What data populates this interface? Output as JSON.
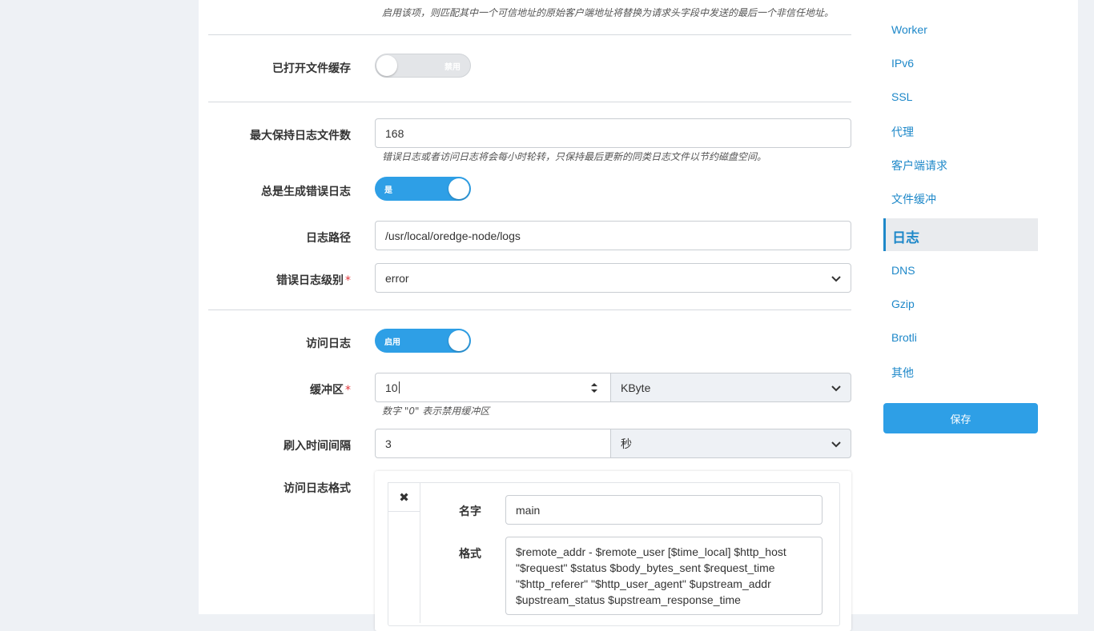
{
  "top_hint": "启用该项，则匹配其中一个可信地址的原始客户端地址将替换为请求头字段中发送的最后一个非信任地址。",
  "open_file_cache": {
    "label": "已打开文件缓存",
    "state": "禁用",
    "enabled": false
  },
  "max_log_files": {
    "label": "最大保持日志文件数",
    "value": "168",
    "hint": "错误日志或者访问日志将会每小时轮转，只保持最后更新的同类日志文件以节约磁盘空间。"
  },
  "always_error_log": {
    "label": "总是生成错误日志",
    "state": "是",
    "enabled": true
  },
  "log_path": {
    "label": "日志路径",
    "value": "/usr/local/oredge-node/logs"
  },
  "error_log_level": {
    "label": "错误日志级别",
    "required": "*",
    "value": "error"
  },
  "access_log": {
    "label": "访问日志",
    "state": "启用",
    "enabled": true
  },
  "buffer": {
    "label": "缓冲区",
    "required": "*",
    "value": "10",
    "unit": "KByte",
    "hint": "数字 \"0\" 表示禁用缓冲区"
  },
  "flush_interval": {
    "label": "刷入时间间隔",
    "value": "3",
    "unit": "秒"
  },
  "access_log_format": {
    "label": "访问日志格式",
    "close_symbol": "✖",
    "name_label": "名字",
    "name_value": "main",
    "format_label": "格式",
    "format_value": "$remote_addr - $remote_user [$time_local] $http_host \"$request\" $status $body_bytes_sent $request_time \"$http_referer\" \"$http_user_agent\" $upstream_addr $upstream_status $upstream_response_time"
  },
  "sidebar": {
    "items": [
      "Worker",
      "IPv6",
      "SSL",
      "代理",
      "客户端请求",
      "文件缓冲"
    ],
    "active": "日志",
    "items_after": [
      "DNS",
      "Gzip",
      "Brotli",
      "其他"
    ],
    "save": "保存"
  },
  "colors": {
    "accent": "#2e9fe6",
    "link": "#1e88c9",
    "required": "#e0343a"
  }
}
